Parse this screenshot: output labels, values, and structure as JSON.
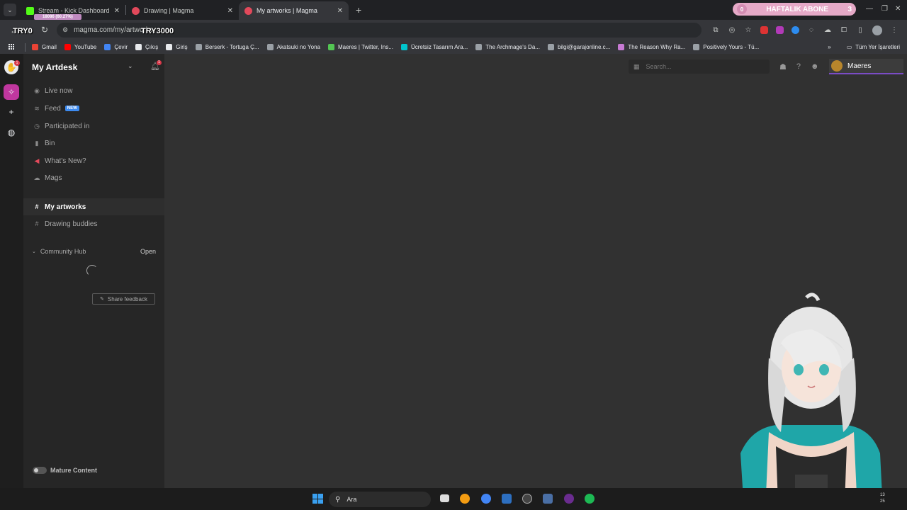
{
  "browser": {
    "tabs": [
      {
        "title": "Stream - Kick Dashboard",
        "favicon_color": "#53fc18",
        "active": false
      },
      {
        "title": "Drawing | Magma",
        "favicon_color": "#e2495b",
        "active": false
      },
      {
        "title": "My artworks | Magma",
        "favicon_color": "#e2495b",
        "active": true
      }
    ],
    "new_tab_label": "+",
    "stream_overlay_text": "18086 (60.27%)",
    "sub_goal": {
      "count": "0",
      "label": "HAFTALIK ABONE",
      "target": "3"
    },
    "address": "magma.com/my/artworks",
    "overlay_try_left": "TRY0",
    "overlay_try_right": "TRY3000",
    "bookmarks": [
      {
        "label": "Gmail",
        "color": "#ea4335"
      },
      {
        "label": "YouTube",
        "color": "#ff0000"
      },
      {
        "label": "Çevir",
        "color": "#4285f4"
      },
      {
        "label": "Çıkış",
        "color": "#e8eaed"
      },
      {
        "label": "Giriş",
        "color": "#e8eaed"
      },
      {
        "label": "Berserk - Tortuga Ç...",
        "color": "#9aa0a6"
      },
      {
        "label": "Akatsuki no Yona",
        "color": "#9aa0a6"
      },
      {
        "label": "Maeres | Twitter, Ins...",
        "color": "#53c653"
      },
      {
        "label": "Ücretsiz Tasarım Ara...",
        "color": "#00c4cc"
      },
      {
        "label": "The Archmage's Da...",
        "color": "#9aa0a6"
      },
      {
        "label": "bilgi@garajonline.c...",
        "color": "#9aa0a6"
      },
      {
        "label": "The Reason Why Ra...",
        "color": "#c77ad4"
      },
      {
        "label": "Positively Yours - Tü...",
        "color": "#9aa0a6"
      }
    ],
    "all_bookmarks_label": "Tüm Yer İşaretleri"
  },
  "app": {
    "rail_notification_count": "1",
    "sidebar": {
      "title": "My Artdesk",
      "bell_count": "1",
      "items": [
        {
          "label": "Live now",
          "icon": "broadcast-icon",
          "glyph": "◉"
        },
        {
          "label": "Feed",
          "icon": "rss-icon",
          "glyph": "⌁",
          "badge": "NEW"
        },
        {
          "label": "Participated in",
          "icon": "clock-icon",
          "glyph": "◷"
        },
        {
          "label": "Bin",
          "icon": "trash-icon",
          "glyph": "▮"
        },
        {
          "label": "What's New?",
          "icon": "megaphone-icon",
          "glyph": "◀"
        },
        {
          "label": "Mags",
          "icon": "mags-icon",
          "glyph": "☁"
        }
      ],
      "channels": [
        {
          "label": "My artworks",
          "active": true
        },
        {
          "label": "Drawing buddies",
          "active": false
        }
      ],
      "community_hub": {
        "label": "Community Hub",
        "action": "Open"
      },
      "share_feedback": "Share feedback",
      "mature_content": "Mature Content"
    },
    "search_placeholder": "Search...",
    "user_name": "Maeres"
  },
  "taskbar": {
    "search_label": "Ara",
    "clock_top": "13",
    "clock_bottom": "25"
  }
}
